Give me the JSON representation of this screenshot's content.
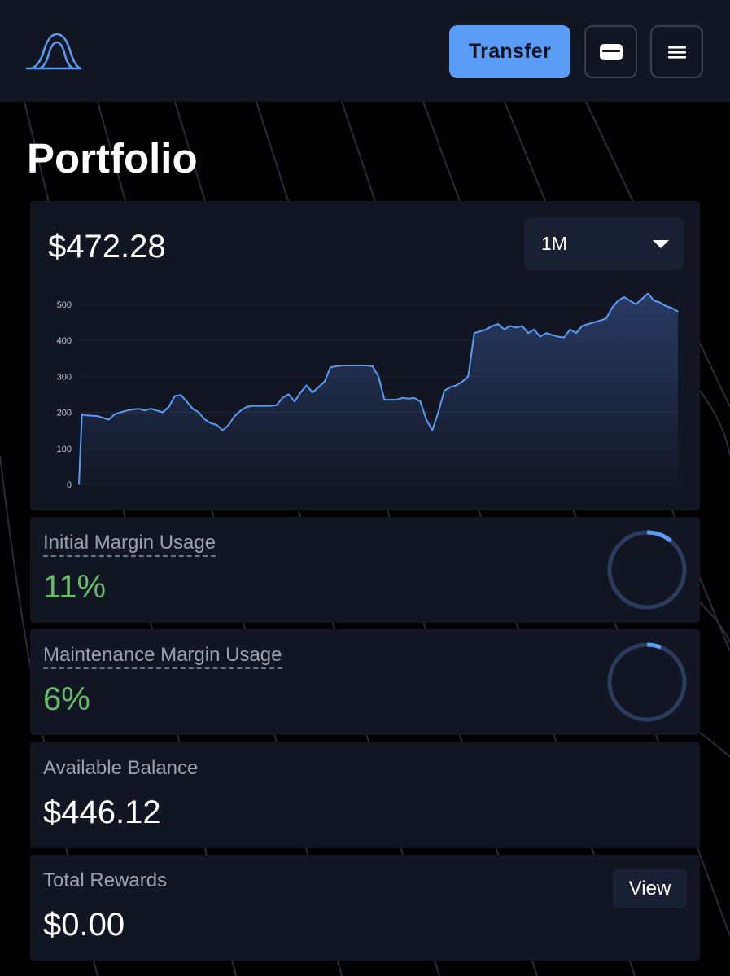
{
  "header": {
    "logo_icon": "app-logo-icon",
    "transfer_label": "Transfer",
    "wallet_icon": "wallet-icon",
    "menu_icon": "hamburger-menu-icon",
    "accent_color": "#5b9cf6"
  },
  "page": {
    "title": "Portfolio"
  },
  "portfolio": {
    "value": "$472.28",
    "range_selected": "1M",
    "range_icon": "chevron-down-icon"
  },
  "chart_data": {
    "type": "area",
    "title": "",
    "xlabel": "",
    "ylabel": "",
    "ylim": [
      0,
      520
    ],
    "yticks": [
      0,
      100,
      200,
      300,
      400,
      500
    ],
    "grid": true,
    "line_color": "#5b9cf6",
    "x": [
      0,
      0.5,
      1,
      3,
      5,
      6,
      7,
      8,
      9,
      10,
      11,
      12,
      13,
      14,
      15,
      16,
      17,
      18,
      19,
      20,
      21,
      22,
      23,
      24,
      25,
      26,
      27,
      28,
      29,
      30,
      31,
      32,
      33,
      34,
      35,
      36,
      37,
      38,
      39,
      40,
      41,
      42,
      43,
      44,
      45,
      46,
      47,
      48,
      49,
      50,
      51,
      52,
      53,
      54,
      55,
      56,
      57,
      58,
      59,
      60,
      61,
      62,
      63,
      64,
      65,
      66,
      67,
      68,
      69,
      70,
      71,
      72,
      73,
      74,
      75,
      76,
      77,
      78,
      79,
      80,
      81,
      82,
      83,
      84,
      85,
      86,
      87,
      88,
      89,
      90,
      91,
      92,
      93,
      94,
      95,
      96,
      97,
      98,
      99,
      100
    ],
    "series": [
      {
        "values": [
          0,
          195,
          192,
          190,
          180,
          195,
          200,
          205,
          208,
          210,
          205,
          210,
          205,
          200,
          215,
          245,
          248,
          230,
          210,
          200,
          180,
          170,
          165,
          150,
          165,
          190,
          205,
          215,
          218,
          218,
          218,
          218,
          220,
          240,
          250,
          230,
          255,
          275,
          255,
          270,
          285,
          325,
          328,
          330,
          330,
          330,
          330,
          330,
          328,
          300,
          235,
          235,
          235,
          240,
          238,
          240,
          230,
          180,
          150,
          200,
          260,
          270,
          275,
          285,
          300,
          420,
          425,
          430,
          440,
          445,
          430,
          440,
          435,
          440,
          420,
          430,
          410,
          420,
          415,
          410,
          408,
          430,
          420,
          440,
          445,
          450,
          455,
          460,
          490,
          510,
          520,
          510,
          500,
          515,
          530,
          510,
          505,
          495,
          490,
          480,
          472
        ]
      }
    ]
  },
  "margins": [
    {
      "label": "Initial Margin Usage",
      "value": "11%",
      "percent": 11,
      "icon": "progress-ring-icon"
    },
    {
      "label": "Maintenance Margin Usage",
      "value": "6%",
      "percent": 6,
      "icon": "progress-ring-icon"
    }
  ],
  "available_balance": {
    "label": "Available Balance",
    "value": "$446.12"
  },
  "rewards": {
    "label": "Total Rewards",
    "value": "$0.00",
    "view_label": "View"
  },
  "colors": {
    "background": "#000000",
    "card": "#121522",
    "positive": "#66bb6a",
    "muted_text": "#9ba1ae",
    "ring_track": "#2b3c5e",
    "ring_fill": "#5b9cf6"
  }
}
